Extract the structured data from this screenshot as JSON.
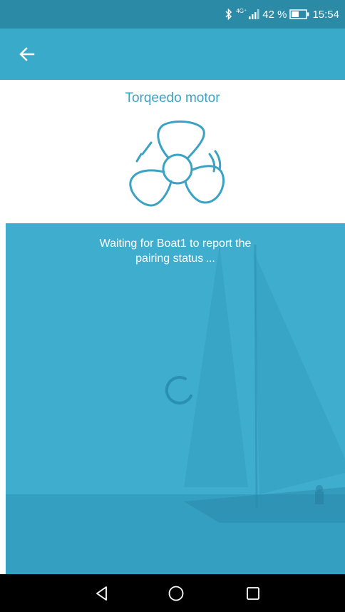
{
  "status_bar": {
    "network_type": "4G⁺",
    "battery_percent": "42 %",
    "time": "15:54",
    "icons": [
      "bluetooth-icon",
      "signal-icon",
      "battery-icon"
    ]
  },
  "app_bar": {
    "back_icon": "arrow-left-icon"
  },
  "main": {
    "device_title": "Torqeedo motor",
    "device_icon": "propeller-icon",
    "waiting_line1": "Waiting for Boat1 to report the",
    "waiting_line2": "pairing status ..."
  },
  "nav_bar": {
    "icons": [
      "back-triangle-icon",
      "home-circle-icon",
      "recents-square-icon"
    ]
  },
  "colors": {
    "status_bar": "#2b8aa6",
    "app_bar": "#3aaacb",
    "accent": "#3aa3c3",
    "panel": "#3eaccc",
    "nav_bar": "#000000"
  }
}
